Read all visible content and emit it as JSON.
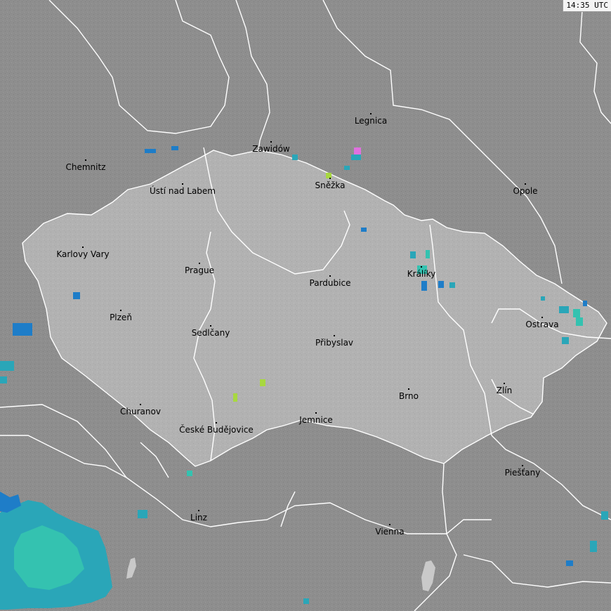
{
  "map": {
    "timestamp": "14:35 UTC",
    "colors": {
      "background": "#8e8e8e",
      "country_fill": "#b2b2b2",
      "border": "#ffffff",
      "water": "#c9c9c9"
    },
    "cities": [
      {
        "name": "Legnica"
      },
      {
        "name": "Zawidów"
      },
      {
        "name": "Chemnitz"
      },
      {
        "name": "Sněžka"
      },
      {
        "name": "Ústí nad Labem"
      },
      {
        "name": "Opole"
      },
      {
        "name": "Karlovy Vary"
      },
      {
        "name": "Prague"
      },
      {
        "name": "Králíky"
      },
      {
        "name": "Pardubice"
      },
      {
        "name": "Plzeň"
      },
      {
        "name": "Ostrava"
      },
      {
        "name": "Sedlčany"
      },
      {
        "name": "Přibyslav"
      },
      {
        "name": "Zlín"
      },
      {
        "name": "Brno"
      },
      {
        "name": "Churanov"
      },
      {
        "name": "České Budějovice"
      },
      {
        "name": "Jemnice"
      },
      {
        "name": "Piešťany"
      },
      {
        "name": "Linz"
      },
      {
        "name": "Vienna"
      }
    ],
    "radar_echo_colors": [
      "#1e7dc8",
      "#2aa6b8",
      "#34c2b0",
      "#a8d840",
      "#e070e0"
    ]
  }
}
